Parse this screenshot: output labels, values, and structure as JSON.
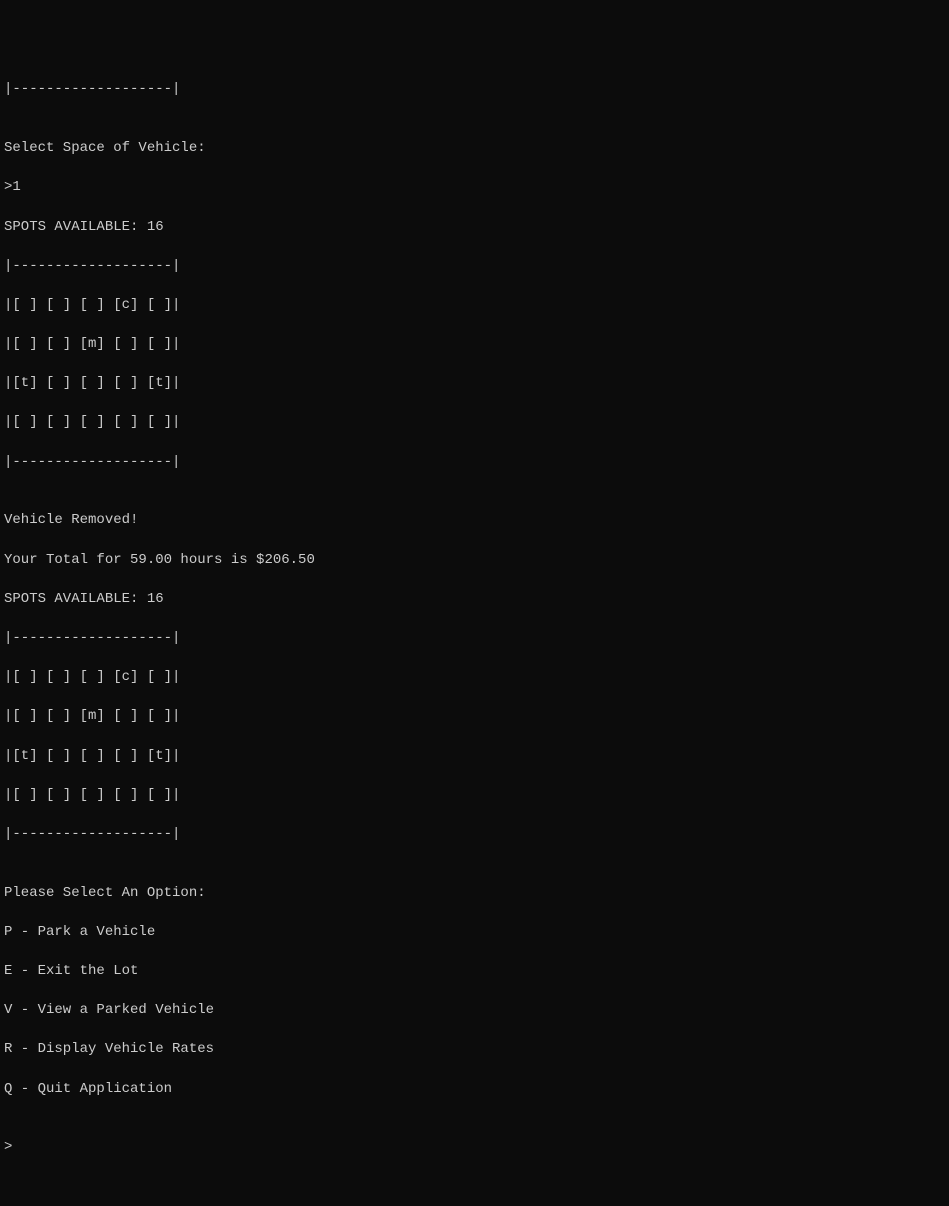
{
  "lines": {
    "divider_top": "|-------------------|",
    "blank": "",
    "select_space": "Select Space of Vehicle:",
    "input_1": ">1",
    "spots_available_1": "SPOTS AVAILABLE: 16",
    "lot_border": "|-------------------|",
    "lot_row1": "|[ ] [ ] [ ] [c] [ ]|",
    "lot_row2": "|[ ] [ ] [m] [ ] [ ]|",
    "lot_row3": "|[t] [ ] [ ] [ ] [t]|",
    "lot_row4": "|[ ] [ ] [ ] [ ] [ ]|",
    "lot_border2": "|-------------------|",
    "vehicle_removed": "Vehicle Removed!",
    "total": "Your Total for 59.00 hours is $206.50",
    "spots_available_2": "SPOTS AVAILABLE: 16",
    "lot2_border": "|-------------------|",
    "lot2_row1": "|[ ] [ ] [ ] [c] [ ]|",
    "lot2_row2": "|[ ] [ ] [m] [ ] [ ]|",
    "lot2_row3": "|[t] [ ] [ ] [ ] [t]|",
    "lot2_row4": "|[ ] [ ] [ ] [ ] [ ]|",
    "lot2_border2": "|-------------------|",
    "menu_header": "Please Select An Option:",
    "menu_p": "P - Park a Vehicle",
    "menu_e": "E - Exit the Lot",
    "menu_v": "V - View a Parked Vehicle",
    "menu_r": "R - Display Vehicle Rates",
    "menu_q": "Q - Quit Application",
    "prompt": ">"
  }
}
